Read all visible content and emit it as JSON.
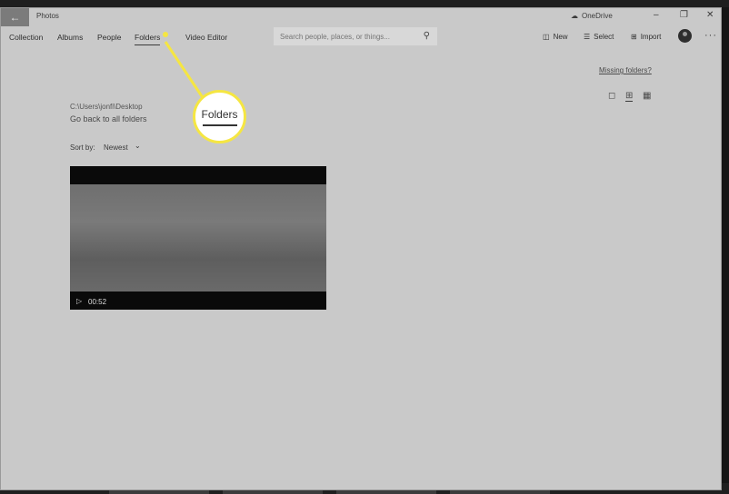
{
  "window": {
    "app_title": "Photos",
    "onedrive_label": "OneDrive"
  },
  "nav": {
    "items": [
      "Collection",
      "Albums",
      "People",
      "Folders",
      "Video Editor"
    ],
    "active": "Folders"
  },
  "search": {
    "placeholder": "Search people, places, or things..."
  },
  "toolbar": {
    "new_label": "New",
    "select_label": "Select",
    "import_label": "Import"
  },
  "folder": {
    "missing_folders_link": "Missing folders?",
    "path": "C:\\Users\\jonfi\\Desktop",
    "go_back_label": "Go back to all folders",
    "sort_label": "Sort by:",
    "sort_value": "Newest"
  },
  "video": {
    "duration": "00:52"
  },
  "callout": {
    "label": "Folders",
    "color": "#f5e642"
  }
}
